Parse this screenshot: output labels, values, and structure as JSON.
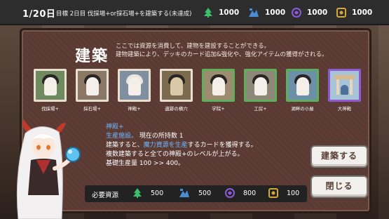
{
  "hud": {
    "day": "1/20日",
    "goal": "目標 2日目 伐採場+or採石場+を建築する(未達成)",
    "resources": [
      {
        "icon": "tree-icon",
        "value": "1000",
        "color": "#3bbf6a"
      },
      {
        "icon": "stone-icon",
        "value": "1000",
        "color": "#4a8bd6"
      },
      {
        "icon": "magic-icon",
        "value": "1000",
        "color": "#8d5ad8"
      },
      {
        "icon": "gear-icon",
        "value": "1000",
        "color": "#d6a83b"
      }
    ]
  },
  "panel": {
    "title": "建築",
    "description": "ここでは資源を消費して、建物を建設することができる。\n建物建築により、デッキのカード追加&強化や、強化アイテムの獲得がされる。"
  },
  "cards": [
    {
      "label": "伐採場+",
      "frame": "white"
    },
    {
      "label": "採石場+",
      "frame": "white"
    },
    {
      "label": "神殿+",
      "frame": "white"
    },
    {
      "label": "遺跡の横穴",
      "frame": "white"
    },
    {
      "label": "学院+",
      "frame": "green"
    },
    {
      "label": "工房+",
      "frame": "green"
    },
    {
      "label": "湖畔の小屋",
      "frame": "green"
    },
    {
      "label": "大神殿",
      "frame": "purple"
    }
  ],
  "info": {
    "name": "神殿+",
    "type_label": "生産施設。",
    "count_text": "現在の所持数 1",
    "line2_a": "建築すると、",
    "line2_b": "魔力資源を生産",
    "line2_c": "するカードを獲得する。",
    "line3": "複数建築すると全ての神殿+のレベルが上がる。",
    "line4": "基礎生産量 100 >> 400。"
  },
  "buttons": {
    "build": "建築する",
    "close": "閉じる"
  },
  "requirements": {
    "label": "必要資源",
    "items": [
      {
        "icon": "tree-icon",
        "value": "500"
      },
      {
        "icon": "stone-icon",
        "value": "500"
      },
      {
        "icon": "magic-icon",
        "value": "800"
      },
      {
        "icon": "gear-icon",
        "value": "100"
      }
    ]
  }
}
